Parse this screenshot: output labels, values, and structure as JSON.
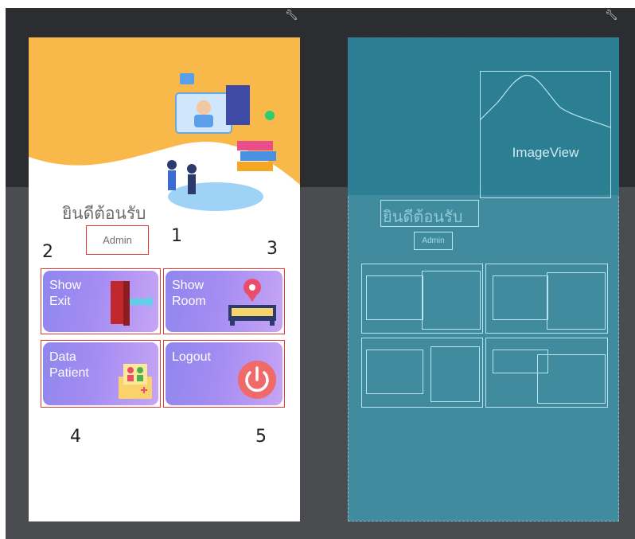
{
  "toolbar": {
    "wrench_icon": "wrench-icon"
  },
  "design": {
    "welcome_text": "ยินดีต้อนรับ",
    "admin_label": "Admin",
    "tiles": [
      {
        "label": "Show\nExit",
        "icon": "exit-door-icon"
      },
      {
        "label": "Show\nRoom",
        "icon": "room-bed-icon"
      },
      {
        "label": "Data\nPatient",
        "icon": "patient-data-icon"
      },
      {
        "label": "Logout",
        "icon": "power-icon"
      }
    ],
    "annotations": [
      "1",
      "2",
      "3",
      "4",
      "5"
    ]
  },
  "blueprint": {
    "imageview_label": "ImageView",
    "welcome_text": "ยินดีต้อนรับ",
    "admin_label": "Admin"
  },
  "colors": {
    "header_orange": "#f9b94a",
    "tile_gradient_start": "#8f86ee",
    "tile_gradient_end": "#c6a5f5",
    "highlight_red": "#e53935",
    "blueprint_blue": "#3f9db5"
  }
}
